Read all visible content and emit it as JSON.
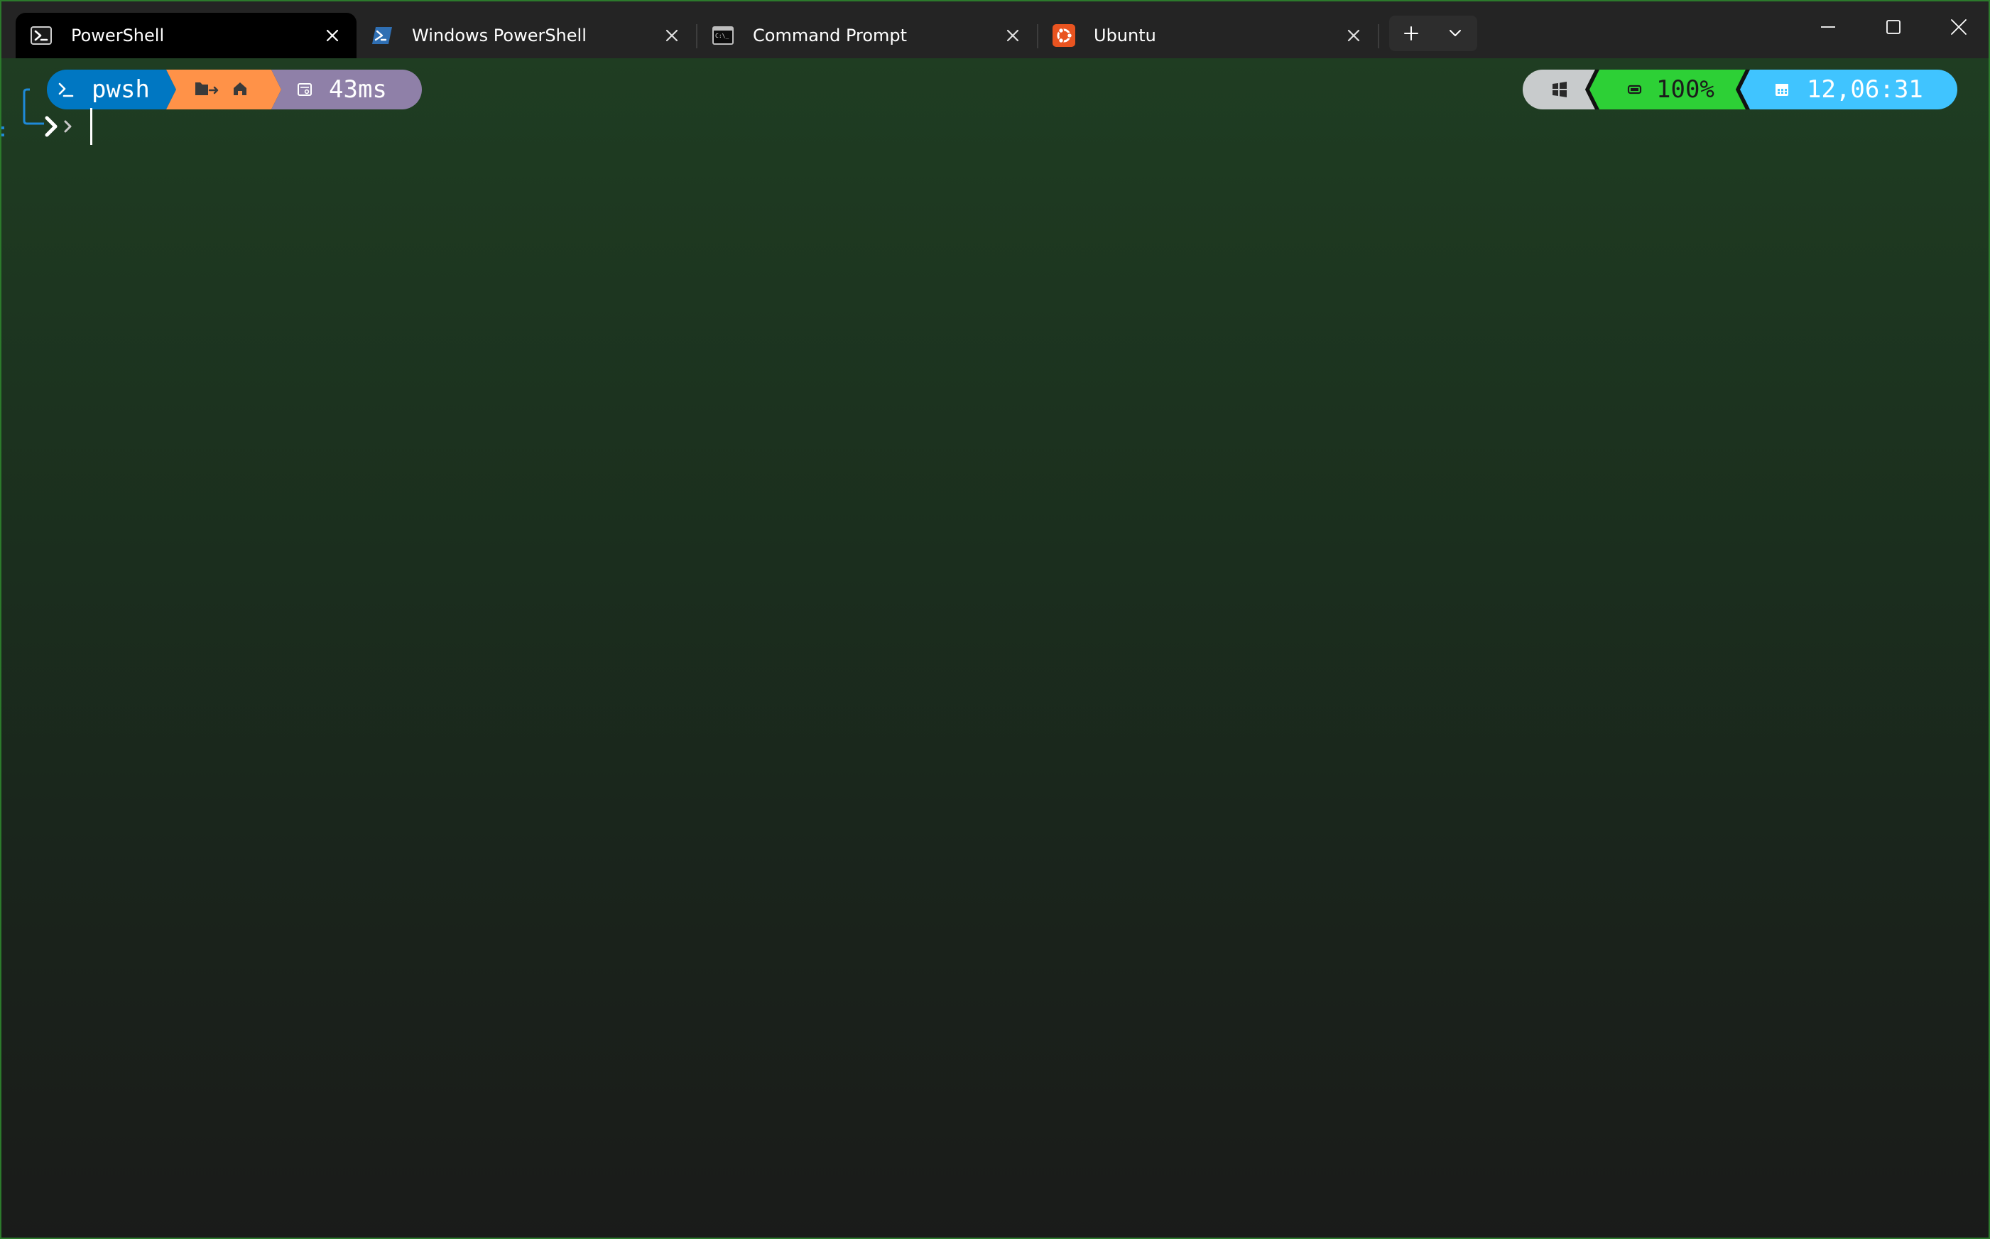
{
  "tabs": [
    {
      "title": "PowerShell",
      "icon": "powershell-icon",
      "active": true
    },
    {
      "title": "Windows PowerShell",
      "icon": "windows-powershell-icon",
      "active": false
    },
    {
      "title": "Command Prompt",
      "icon": "command-prompt-icon",
      "active": false
    },
    {
      "title": "Ubuntu",
      "icon": "ubuntu-icon",
      "active": false
    }
  ],
  "toolbar": {
    "new_tab_icon": "plus-icon",
    "dropdown_icon": "chevron-down-icon"
  },
  "window_controls": [
    "minimize-icon",
    "maximize-icon",
    "close-icon"
  ],
  "prompt": {
    "shell_segment": {
      "text": "pwsh",
      "color": "#0077c2"
    },
    "path_segment": {
      "icons": [
        "folder-arrow-icon",
        "home-icon"
      ],
      "color": "#ff9248"
    },
    "exec_time_segment": {
      "text": "43ms",
      "color": "#8f80a8"
    },
    "os_segment": {
      "icon": "windows-icon",
      "color": "#c8cbcc"
    },
    "battery_segment": {
      "text": "100%",
      "color": "#2dd036"
    },
    "time_segment": {
      "text": "12,06:31",
      "color": "#40c4ff"
    }
  },
  "colors": {
    "window_border": "#2c7a2c",
    "tab_active_bg": "#000000",
    "titlebar_bg": "#242424"
  }
}
